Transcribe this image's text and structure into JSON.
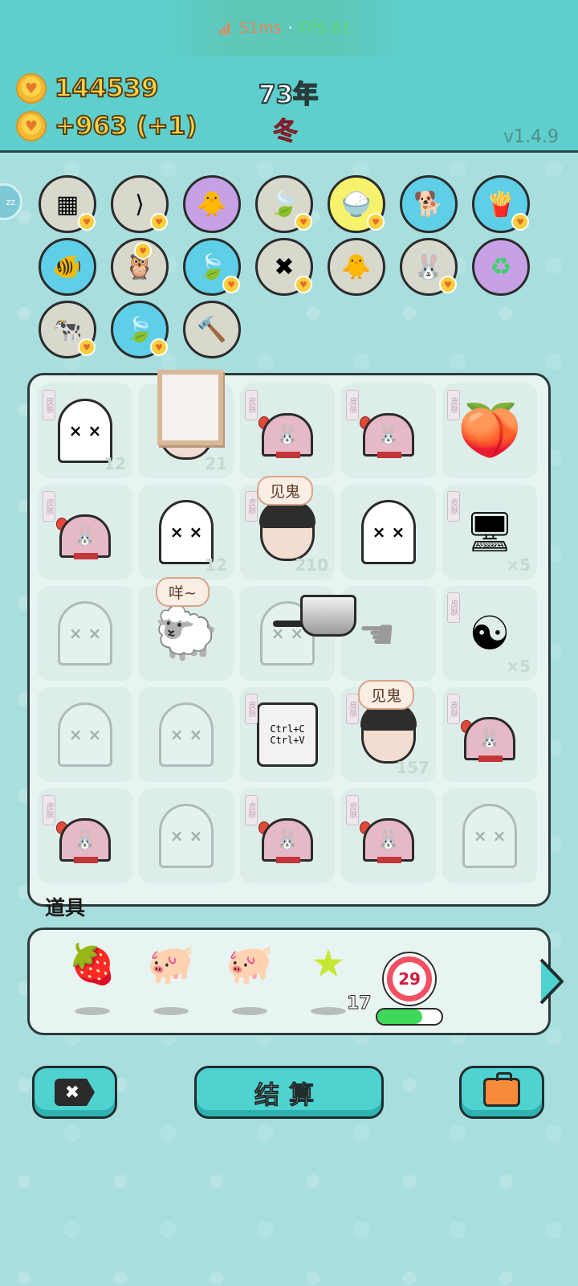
{
  "perf": {
    "ping": "51ms",
    "separator": "·",
    "fps": "FPS 61"
  },
  "stats": {
    "coins": "144539",
    "income": "+963 (+1)",
    "year": "73年",
    "season": "冬",
    "version": "v1.4.9"
  },
  "sleep_badge": "zz",
  "characters": [
    {
      "name": "tofu-cubes",
      "icon": "▦",
      "bg": "#d8d8cc"
    },
    {
      "name": "skip-arrow",
      "icon": "⟩|",
      "bg": "#d8d8cc"
    },
    {
      "name": "chick-egg",
      "icon": "🐥",
      "bg": "#c7a1e6"
    },
    {
      "name": "leaf",
      "icon": "🍃",
      "bg": "#d8d8cc"
    },
    {
      "name": "rice-bowl",
      "icon": "🍚",
      "bg": "#f7f26b"
    },
    {
      "name": "shiba-dog",
      "icon": "🐕",
      "bg": "#5ecfe6"
    },
    {
      "name": "french-fries",
      "icon": "🍟",
      "bg": "#5ecfe6"
    },
    {
      "name": "fish-tank",
      "icon": "🐠",
      "bg": "#5ecfe6"
    },
    {
      "name": "owl-pair",
      "icon": "🦉",
      "bg": "#d8d8cc"
    },
    {
      "name": "leaf",
      "icon": "🍃",
      "bg": "#5ecfe6"
    },
    {
      "name": "exit-tag",
      "icon": "✖",
      "bg": "#d8d8cc"
    },
    {
      "name": "chick-egg",
      "icon": "🐥",
      "bg": "#d8d8cc"
    },
    {
      "name": "bunny",
      "icon": "🐰",
      "bg": "#d8d8cc"
    },
    {
      "name": "recycle",
      "icon": "♻",
      "bg": "#c7a1e6"
    },
    {
      "name": "cow-pair",
      "icon": "🐄",
      "bg": "#d8d8cc"
    },
    {
      "name": "leaf",
      "icon": "🍃",
      "bg": "#5ecfe6"
    },
    {
      "name": "hammer",
      "icon": "🔨",
      "bg": "#d8d8cc"
    }
  ],
  "board": {
    "speech_ghost_1": "见鬼",
    "speech_sheep": "咩~",
    "speech_ghost_2": "见鬼",
    "counts": {
      "ghost_r1": "12",
      "face_r1": "21",
      "ghost_r2": "12",
      "face_r2": "210",
      "gpu_r2": "×5",
      "bagua_r3": "×5",
      "face_r4": "157"
    },
    "copy_paste": [
      "Ctrl+C",
      "Ctrl+V"
    ],
    "tag_text": "皮肤"
  },
  "items": {
    "label": "道具",
    "star_count": "17",
    "timer_value": "29",
    "progress": 0.7
  },
  "buttons": {
    "settle": "结算"
  }
}
